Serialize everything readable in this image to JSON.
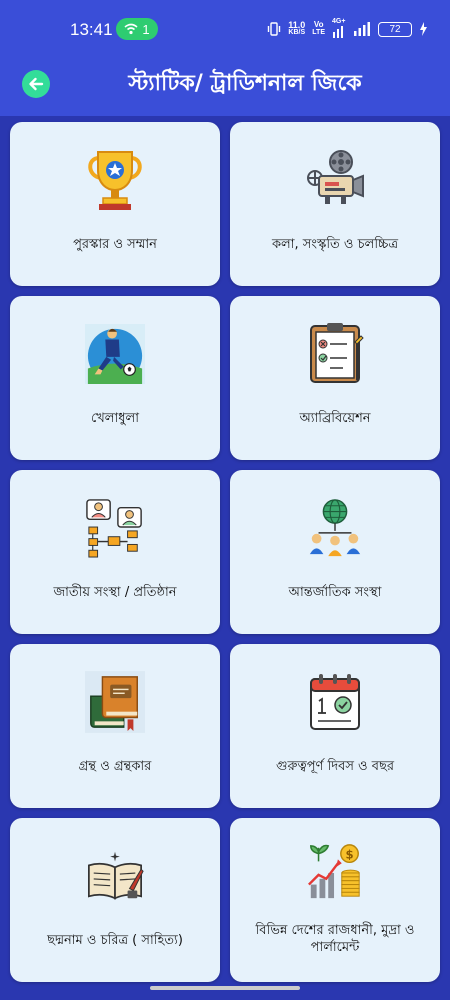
{
  "status_bar": {
    "time": "13:41",
    "hotspot_count": "1",
    "net_speed_value": "11.0",
    "net_speed_unit": "KB/S",
    "volte_top": "Vo",
    "volte_bottom": "LTE",
    "network_type": "4G+",
    "battery_level": "72"
  },
  "app_bar": {
    "title": "স্ট্যাটিক/ ট্রাডিশনাল জিকে"
  },
  "categories": [
    {
      "label": "পুরস্কার ও সম্মান",
      "icon": "trophy-icon"
    },
    {
      "label": "কলা, সংস্কৃতি ও   চলচ্চিত্র",
      "icon": "film-projector-icon"
    },
    {
      "label": "খেলাধুলা",
      "icon": "football-player-icon"
    },
    {
      "label": "অ্যাব্রিবিয়েশন",
      "icon": "clipboard-checklist-icon"
    },
    {
      "label": "জাতীয় সংস্থা / প্রতিষ্ঠান",
      "icon": "organization-chart-icon"
    },
    {
      "label": "আন্তর্জাতিক সংস্থা",
      "icon": "global-network-icon"
    },
    {
      "label": "গ্রন্থ ও গ্রন্থকার",
      "icon": "books-icon"
    },
    {
      "label": "গুরুত্বপূর্ণ দিবস ও বছর",
      "icon": "calendar-icon"
    },
    {
      "label": "ছদ্মনাম ও চরিত্র ( সাহিত্য)",
      "icon": "open-book-quill-icon"
    },
    {
      "label": "বিভিন্ন দেশের রাজধানী, মুদ্রা ও পার্লামেন্ট",
      "icon": "money-growth-icon"
    }
  ],
  "colors": {
    "app_bar": "#3a4ed8",
    "background": "#2a37b0",
    "card": "#e6f2fb",
    "back_button": "#33dd99",
    "hotspot_pill": "#2ecc71"
  }
}
